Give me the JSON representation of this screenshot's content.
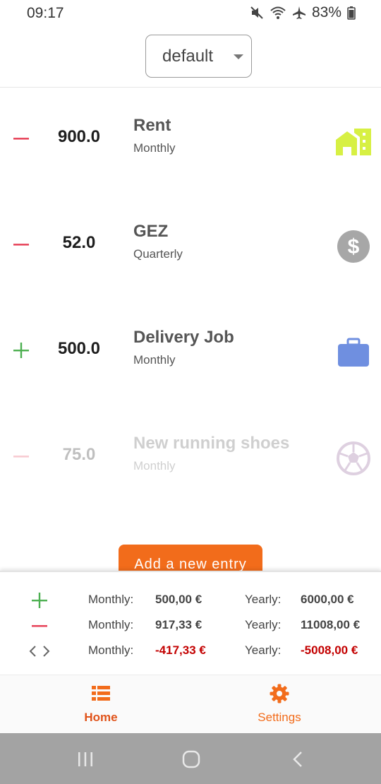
{
  "status_bar": {
    "time": "09:17",
    "battery_percent": "83%",
    "icons": [
      "mute-icon",
      "wifi-icon",
      "airplane-icon",
      "battery-icon"
    ]
  },
  "selector": {
    "value": "default"
  },
  "entries": [
    {
      "sign": "minus",
      "amount": "900.0",
      "name": "Rent",
      "frequency": "Monthly",
      "icon": "home-icon",
      "icon_color": "#d7f043"
    },
    {
      "sign": "minus",
      "amount": "52.0",
      "name": "GEZ",
      "frequency": "Quarterly",
      "icon": "dollar-circle-icon",
      "icon_color": "#a7a7a7"
    },
    {
      "sign": "plus",
      "amount": "500.0",
      "name": "Delivery Job",
      "frequency": "Monthly",
      "icon": "briefcase-icon",
      "icon_color": "#6f8fe0"
    },
    {
      "sign": "minus",
      "amount": "75.0",
      "name": "New running shoes",
      "frequency": "Monthly",
      "icon": "soccer-ball-icon",
      "icon_color": "#c0a6c6"
    }
  ],
  "add_button": {
    "label": "Add a new entry"
  },
  "summary": {
    "income": {
      "monthly_label": "Monthly:",
      "monthly_value": "500,00 €",
      "yearly_label": "Yearly:",
      "yearly_value": "6000,00 €"
    },
    "expense": {
      "monthly_label": "Monthly:",
      "monthly_value": "917,33 €",
      "yearly_label": "Yearly:",
      "yearly_value": "11008,00 €"
    },
    "balance": {
      "monthly_label": "Monthly:",
      "monthly_value": "-417,33 €",
      "yearly_label": "Yearly:",
      "yearly_value": "-5008,00 €"
    }
  },
  "nav": {
    "home_label": "Home",
    "settings_label": "Settings"
  },
  "colors": {
    "accent": "#f26c1b",
    "plus": "#4caf50",
    "minus": "#e84a5f",
    "negative_value": "#c30000"
  }
}
